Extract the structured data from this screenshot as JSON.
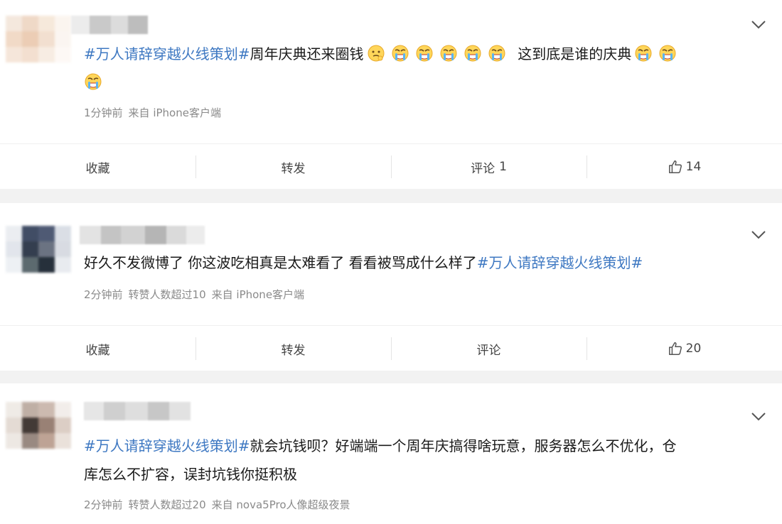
{
  "colors": {
    "hashtag": "#3e78c2",
    "meta": "#8a8a8a",
    "page_bg": "#f2f2f2"
  },
  "posts": [
    {
      "hashtag": "#万人请辞穿越火线策划#",
      "text_a": "周年庆典还来圈钱",
      "text_b": "这到底是谁的庆典",
      "emojis": [
        "thinking-face-icon",
        "crying-face-icon"
      ],
      "meta": {
        "time": "1分钟前",
        "forward_info": "",
        "source": "来自 iPhone客户端"
      },
      "actions": {
        "favorite": "收藏",
        "repost": "转发",
        "comment": "评论",
        "comment_count": "1",
        "like_count": "14"
      }
    },
    {
      "text": "好久不发微博了 你这波吃相真是太难看了 看看被骂成什么样了",
      "hashtag": "#万人请辞穿越火线策划#",
      "meta": {
        "time": "2分钟前",
        "forward_info": "转赞人数超过10",
        "source": "来自 iPhone客户端"
      },
      "actions": {
        "favorite": "收藏",
        "repost": "转发",
        "comment": "评论",
        "comment_count": "",
        "like_count": "20"
      }
    },
    {
      "hashtag": "#万人请辞穿越火线策划#",
      "text_line1": "就会坑钱呗？好端端一个周年庆搞得啥玩意，服务器怎么不优化，仓",
      "text_line2": "库怎么不扩容，误封坑钱你挺积极",
      "meta": {
        "time": "2分钟前",
        "forward_info": "转赞人数超过20",
        "source": "来自 nova5Pro人像超级夜景"
      }
    }
  ]
}
